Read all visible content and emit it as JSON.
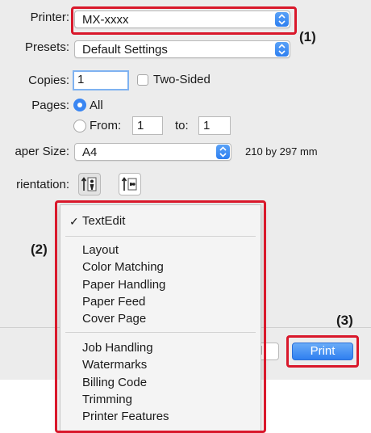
{
  "printer": {
    "label": "Printer:",
    "value": "MX-xxxx"
  },
  "presets": {
    "label": "Presets:",
    "value": "Default Settings"
  },
  "copies": {
    "label": "Copies:",
    "value": "1",
    "two_sided_label": "Two-Sided"
  },
  "pages": {
    "label": "Pages:",
    "all_label": "All",
    "from_label": "From:",
    "from_value": "1",
    "to_label": "to:",
    "to_value": "1"
  },
  "paper_size": {
    "label": "aper Size:",
    "value": "A4",
    "dims": "210 by 297 mm"
  },
  "orientation": {
    "label": "rientation:"
  },
  "menu": {
    "checked_item": "TextEdit",
    "group1": [
      "Layout",
      "Color Matching",
      "Paper Handling",
      "Paper Feed",
      "Cover Page"
    ],
    "group2": [
      "Job Handling",
      "Watermarks",
      "Billing Code",
      "Trimming",
      "Printer Features"
    ]
  },
  "buttons": {
    "print": "Print",
    "cancel_fragment": "l"
  },
  "callouts": {
    "c1": "(1)",
    "c2": "(2)",
    "c3": "(3)"
  },
  "colors": {
    "highlight": "#d9182b",
    "accent": "#3a86f2"
  }
}
